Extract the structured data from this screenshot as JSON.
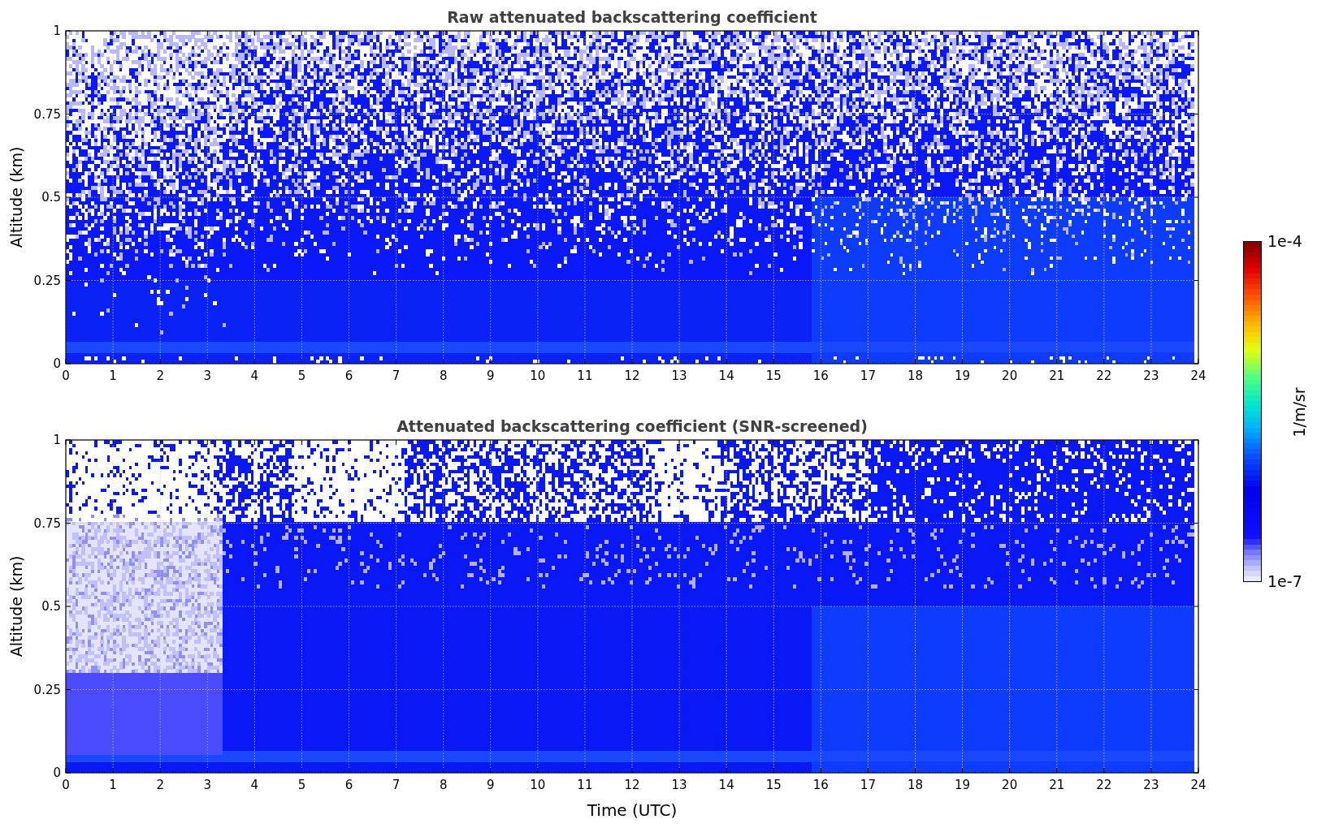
{
  "panels": [
    {
      "title": "Raw attenuated backscattering coefficient",
      "ylabel": "Altitude (km)",
      "yticks": [
        "1",
        "0.75",
        "0.5",
        "0.25",
        "0"
      ],
      "xticks": [
        "0",
        "1",
        "2",
        "3",
        "4",
        "5",
        "6",
        "7",
        "8",
        "9",
        "10",
        "11",
        "12",
        "13",
        "14",
        "15",
        "16",
        "17",
        "18",
        "19",
        "20",
        "21",
        "22",
        "23",
        "24"
      ],
      "kind": "raw"
    },
    {
      "title": "Attenuated backscattering coefficient (SNR-screened)",
      "ylabel": "Altitude (km)",
      "yticks": [
        "1",
        "0.75",
        "0.5",
        "0.25",
        "0"
      ],
      "xticks": [
        "0",
        "1",
        "2",
        "3",
        "4",
        "5",
        "6",
        "7",
        "8",
        "9",
        "10",
        "11",
        "12",
        "13",
        "14",
        "15",
        "16",
        "17",
        "18",
        "19",
        "20",
        "21",
        "22",
        "23",
        "24"
      ],
      "kind": "screened"
    }
  ],
  "xlabel": "Time (UTC)",
  "colorbar": {
    "max_label": "1e-4",
    "min_label": "1e-7",
    "unit": "1/m/sr"
  }
}
